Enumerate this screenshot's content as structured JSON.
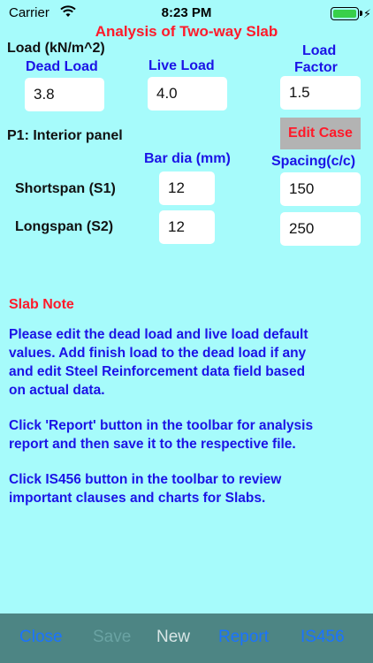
{
  "status": {
    "carrier": "Carrier",
    "time": "8:23 PM"
  },
  "title": "Analysis of Two-way Slab",
  "load": {
    "heading": "Load (kN/m^2)",
    "dead_label": "Dead Load",
    "live_label": "Live Load",
    "factor_label_1": "Load",
    "factor_label_2": "Factor",
    "dead_value": "3.8",
    "live_value": "4.0",
    "factor_value": "1.5"
  },
  "panel": {
    "label": "P1: Interior panel",
    "edit_button": "Edit Case"
  },
  "reinforcement": {
    "bar_dia_header": "Bar dia (mm)",
    "spacing_header": "Spacing(c/c)",
    "rows": [
      {
        "label": "Shortspan (S1)",
        "bar_dia": "12",
        "spacing": "150"
      },
      {
        "label": "Longspan (S2)",
        "bar_dia": "12",
        "spacing": "250"
      }
    ]
  },
  "note": {
    "heading": "Slab Note",
    "p1_l1": "Please edit the dead load and live load default",
    "p1_l2": "values.  Add finish load to the dead load if any",
    "p1_l3": "and edit Steel Reinforcement data field based",
    "p1_l4": "on actual data.",
    "p2_l1": "Click 'Report' button in the toolbar for analysis",
    "p2_l2": "report and then save it to the respective file.",
    "p3_l1": "Click IS456 button in the toolbar to review",
    "p3_l2": "important clauses and charts for Slabs."
  },
  "toolbar": {
    "close": "Close",
    "save": "Save",
    "new": "New",
    "report": "Report",
    "is456": "IS456"
  },
  "colors": {
    "background": "#a6fbfb",
    "title_red": "#ff1a2a",
    "label_blue": "#1b13e6",
    "toolbar_bg": "#4d8584",
    "toolbar_active": "#1a73ff"
  }
}
